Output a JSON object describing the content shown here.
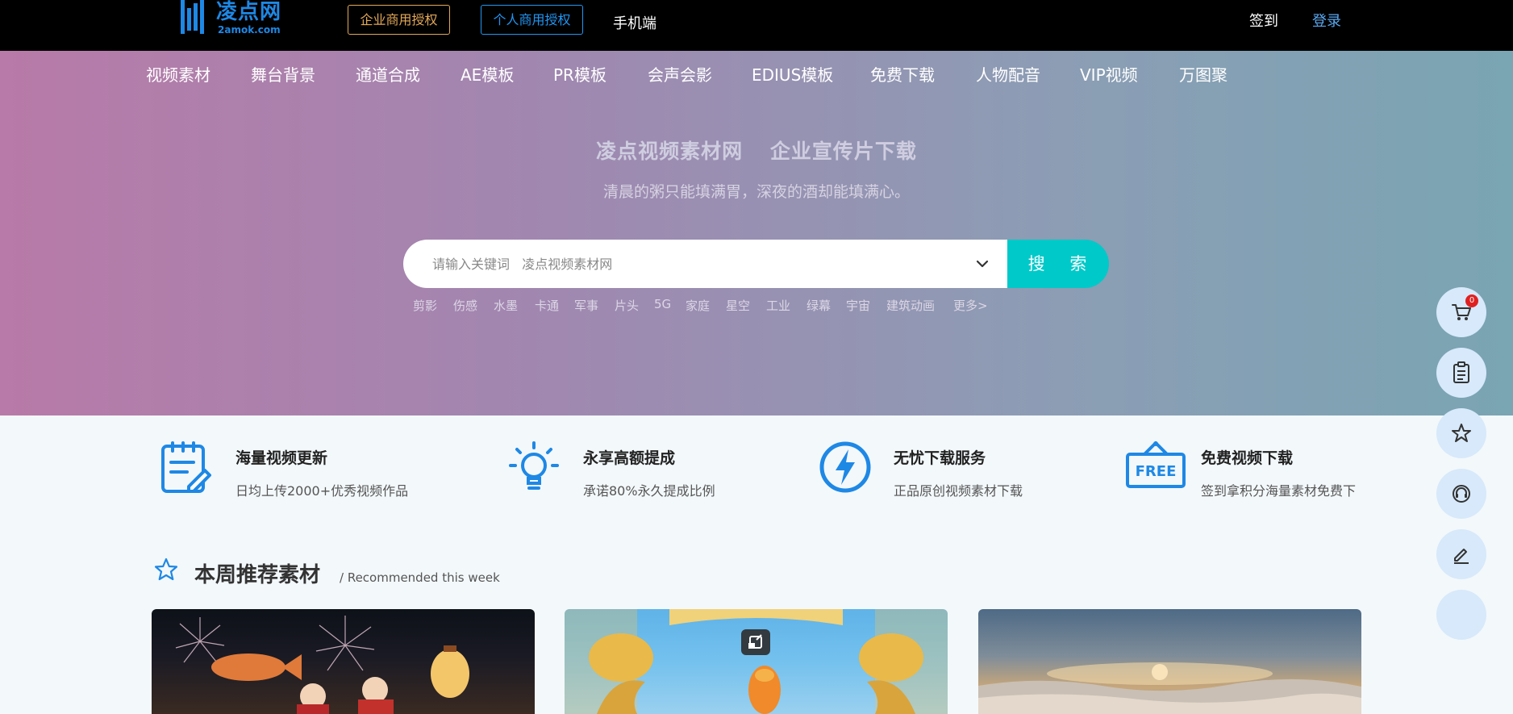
{
  "topbar": {
    "logo_cn": "凌点网",
    "logo_en": "2amok.com",
    "enterprise_license": "企业商用授权",
    "personal_license": "个人商用授权",
    "mobile": "手机端",
    "signin": "签到",
    "login": "登录"
  },
  "nav": [
    "视频素材",
    "舞台背景",
    "通道合成",
    "AE模板",
    "PR模板",
    "会声会影",
    "EDIUS模板",
    "免费下载",
    "人物配音",
    "VIP视频",
    "万图聚"
  ],
  "hero": {
    "title_left": "凌点视频素材网",
    "title_right": "企业宣传片下载",
    "subtitle": "清晨的粥只能填满胃，深夜的酒却能填满心。"
  },
  "search": {
    "placeholder": "请输入关键词   凌点视频素材网",
    "button": "搜 索"
  },
  "tags": [
    "剪影",
    "伤感",
    "水墨",
    "卡通",
    "军事",
    "片头",
    "5G",
    "家庭",
    "星空",
    "工业",
    "绿幕",
    "宇宙",
    "建筑动画",
    "更多>"
  ],
  "floating": {
    "cart_count": "0",
    "icons": [
      "cart-icon",
      "clipboard-icon",
      "star-icon",
      "headset-icon",
      "edit-icon",
      "blank"
    ]
  },
  "features": [
    {
      "title": "海量视频更新",
      "desc": "日均上传2000+优秀视频作品",
      "icon": "doc-edit-icon"
    },
    {
      "title": "永享高额提成",
      "desc": "承诺80%永久提成比例",
      "icon": "lightbulb-icon"
    },
    {
      "title": "无忧下载服务",
      "desc": "正品原创视频素材下载",
      "icon": "lightning-icon"
    },
    {
      "title": "免费视频下载",
      "desc": "签到拿积分海量素材免费下",
      "icon": "free-sign-icon"
    }
  ],
  "section": {
    "title": "本周推荐素材",
    "subtitle": "/ Recommended this week"
  },
  "colors": {
    "accent_teal": "#00c9c9",
    "brand_blue": "#1e88e5",
    "enterprise_gold": "#e3a857"
  }
}
